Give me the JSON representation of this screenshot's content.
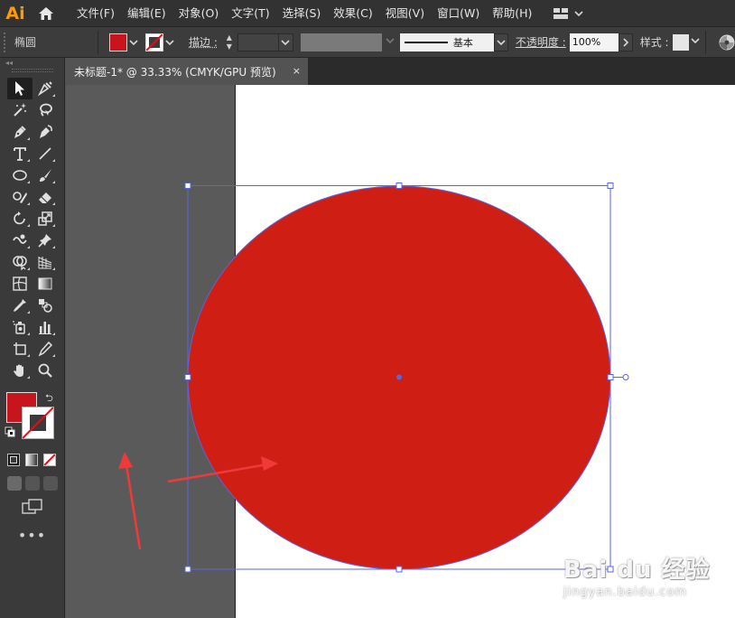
{
  "app": {
    "logo_text": "Ai"
  },
  "menu": [
    "文件(F)",
    "编辑(E)",
    "对象(O)",
    "文字(T)",
    "选择(S)",
    "效果(C)",
    "视图(V)",
    "窗口(W)",
    "帮助(H)"
  ],
  "control_bar": {
    "shape_label": "椭圆",
    "stroke_label": "描边 :",
    "brush_label": "基本",
    "opacity_label": "不透明度 :",
    "opacity_value": "100%",
    "style_label": "样式 :"
  },
  "document": {
    "tab_title": "未标题-1* @ 33.33% (CMYK/GPU 预览)",
    "close_glyph": "×"
  },
  "shape": {
    "type": "ellipse",
    "fill_color": "#cf1f15",
    "bbox_color": "#5a64e0"
  },
  "colors": {
    "fill": "#c8141c",
    "stroke": "none",
    "arrow": "#f03a3a"
  },
  "watermark": {
    "brand": "Bai du 经验",
    "url": "jingyan.baidu.com"
  }
}
